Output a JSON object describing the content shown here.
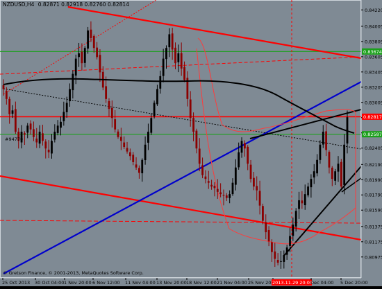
{
  "header": {
    "symbol_timeframe": "NZDUSD,H4",
    "ohlc": "0.82871 0.82918 0.82760 0.82814"
  },
  "copyright": "© Gretson Finance, © 2001-2013, MetaQuotes Software Corp.",
  "left_label": "#94770",
  "colors": {
    "background": "#7f8a94",
    "plot_border": "#cfd6dc",
    "grid": "#9aa3ab",
    "text": "#000000",
    "bull_candle": "#000000",
    "bear_candle": "#8b0000",
    "red_line": "#ff0000",
    "green_line": "#1aa01a",
    "blue_line": "#0000cc",
    "ma_line": "#000000",
    "envelope": "#ff3b3b",
    "price_tag_red": "#ff0000",
    "price_tag_green": "#1aa01a",
    "time_tag": "#ff0000"
  },
  "chart_data": {
    "type": "candlestick",
    "symbol": "NZDUSD",
    "timeframe": "H4",
    "ylim": [
      0.807,
      0.8435
    ],
    "grid": true,
    "y_ticks": [
      "0.84220",
      "0.84005",
      "0.83805",
      "0.83605",
      "0.83405",
      "0.83205",
      "0.83005",
      "0.82805",
      "0.82605",
      "0.82405",
      "0.82190",
      "0.81990",
      "0.81790",
      "0.81590",
      "0.81375",
      "0.81175",
      "0.80975"
    ],
    "x_ticks": [
      "25 Oct 2013",
      "30 Oct 04:00",
      "1 Nov 20:00",
      "6 Nov 12:00",
      "11 Nov 04:00",
      "13 Nov 20:00",
      "18 Nov 12:00",
      "21 Nov 04:00",
      "25 Nov 20:00",
      "2013.11.29 20:00",
      "Dec 04:00",
      "5 Dec 20:00"
    ],
    "time_marker": "2013.11.29 20:00",
    "price_tags": [
      {
        "value": 0.83674,
        "text": "0.83674",
        "kind": "green"
      },
      {
        "value": 0.82817,
        "text": "0.82817",
        "kind": "red"
      },
      {
        "value": 0.82587,
        "text": "0.82587",
        "kind": "green"
      }
    ],
    "horizontal_levels": [
      {
        "value": 0.83674,
        "kind": "green"
      },
      {
        "value": 0.82817,
        "kind": "red"
      },
      {
        "value": 0.82587,
        "kind": "green"
      }
    ],
    "close_series": [
      0.8318,
      0.8305,
      0.8285,
      0.829,
      0.8262,
      0.825,
      0.8262,
      0.8258,
      0.827,
      0.8265,
      0.8255,
      0.8248,
      0.8262,
      0.825,
      0.824,
      0.8235,
      0.825,
      0.8262,
      0.827,
      0.8275,
      0.8288,
      0.83,
      0.8318,
      0.8338,
      0.8358,
      0.8365,
      0.8352,
      0.8372,
      0.8395,
      0.8385,
      0.8372,
      0.836,
      0.834,
      0.832,
      0.8305,
      0.8292,
      0.828,
      0.8265,
      0.8255,
      0.825,
      0.8242,
      0.8236,
      0.823,
      0.8222,
      0.8215,
      0.8208,
      0.8225,
      0.8245,
      0.8262,
      0.828,
      0.83,
      0.8318,
      0.8335,
      0.8358,
      0.8372,
      0.839,
      0.837,
      0.8352,
      0.8365,
      0.8345,
      0.833,
      0.8305,
      0.828,
      0.8262,
      0.824,
      0.822,
      0.8205,
      0.82,
      0.8195,
      0.819,
      0.8188,
      0.8183,
      0.818,
      0.8178,
      0.8175,
      0.818,
      0.8195,
      0.8215,
      0.8235,
      0.825,
      0.824,
      0.822,
      0.82,
      0.819,
      0.8185,
      0.8165,
      0.8145,
      0.813,
      0.8118,
      0.8104,
      0.8095,
      0.809,
      0.8092,
      0.81,
      0.811,
      0.8125,
      0.814,
      0.8158,
      0.8172,
      0.8168,
      0.818,
      0.819,
      0.82,
      0.821,
      0.8225,
      0.8245,
      0.8262,
      0.8238,
      0.8215,
      0.82,
      0.821,
      0.822,
      0.819,
      0.8245,
      0.8281
    ]
  }
}
